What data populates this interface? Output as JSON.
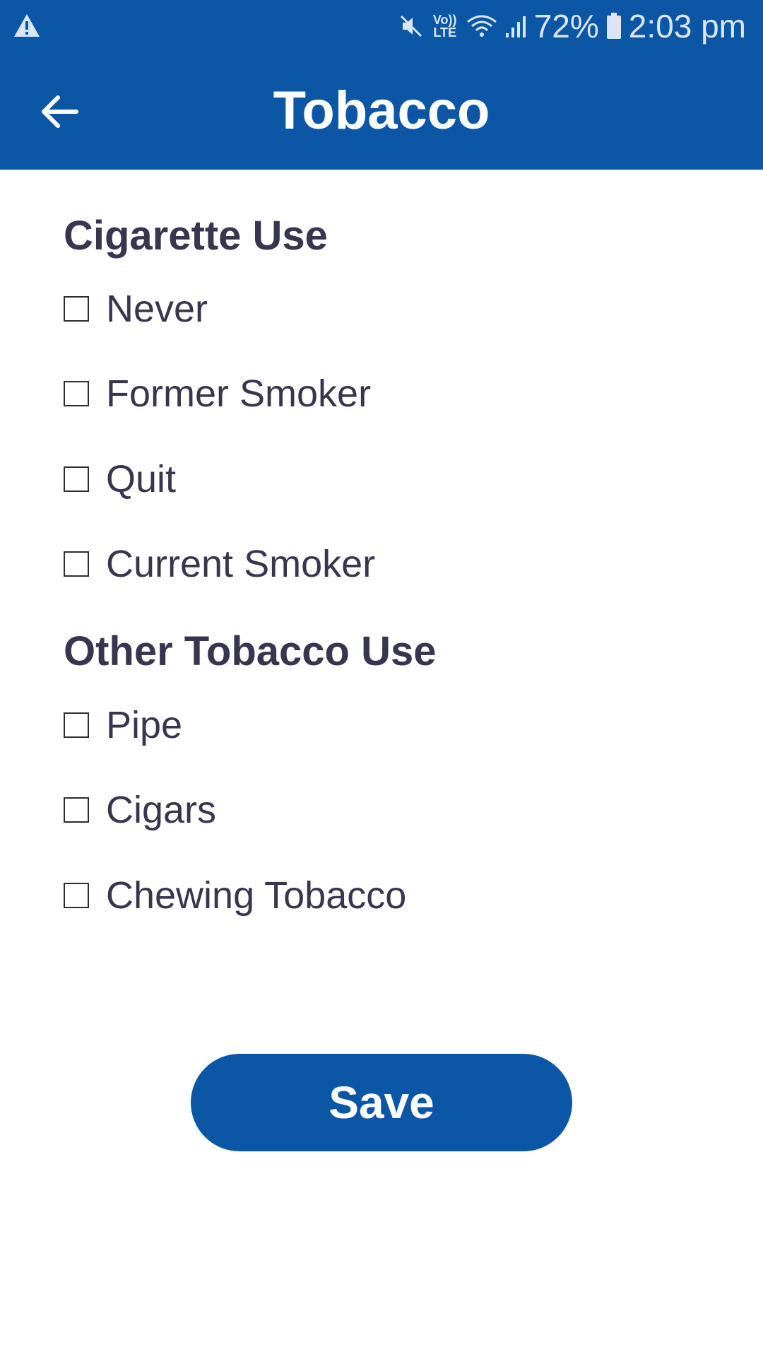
{
  "status_bar": {
    "battery": "72%",
    "time": "2:03 pm",
    "volte_label_top": "Vo))",
    "volte_label_bottom": "LTE",
    "icons": [
      "warning-icon",
      "mute-icon",
      "volte-icon",
      "wifi-icon",
      "signal-icon",
      "battery-icon"
    ]
  },
  "app_bar": {
    "title": "Tobacco",
    "back_icon": "arrow-left-icon"
  },
  "sections": [
    {
      "heading": "Cigarette Use",
      "options": [
        {
          "label": "Never",
          "checked": false
        },
        {
          "label": "Former Smoker",
          "checked": false
        },
        {
          "label": "Quit",
          "checked": false
        },
        {
          "label": "Current Smoker",
          "checked": false
        }
      ]
    },
    {
      "heading": "Other Tobacco Use",
      "options": [
        {
          "label": "Pipe",
          "checked": false
        },
        {
          "label": "Cigars",
          "checked": false
        },
        {
          "label": "Chewing Tobacco",
          "checked": false
        }
      ]
    }
  ],
  "save_label": "Save",
  "colors": {
    "primary": "#0b57a6",
    "text": "#38364e",
    "background": "#ffffff"
  }
}
